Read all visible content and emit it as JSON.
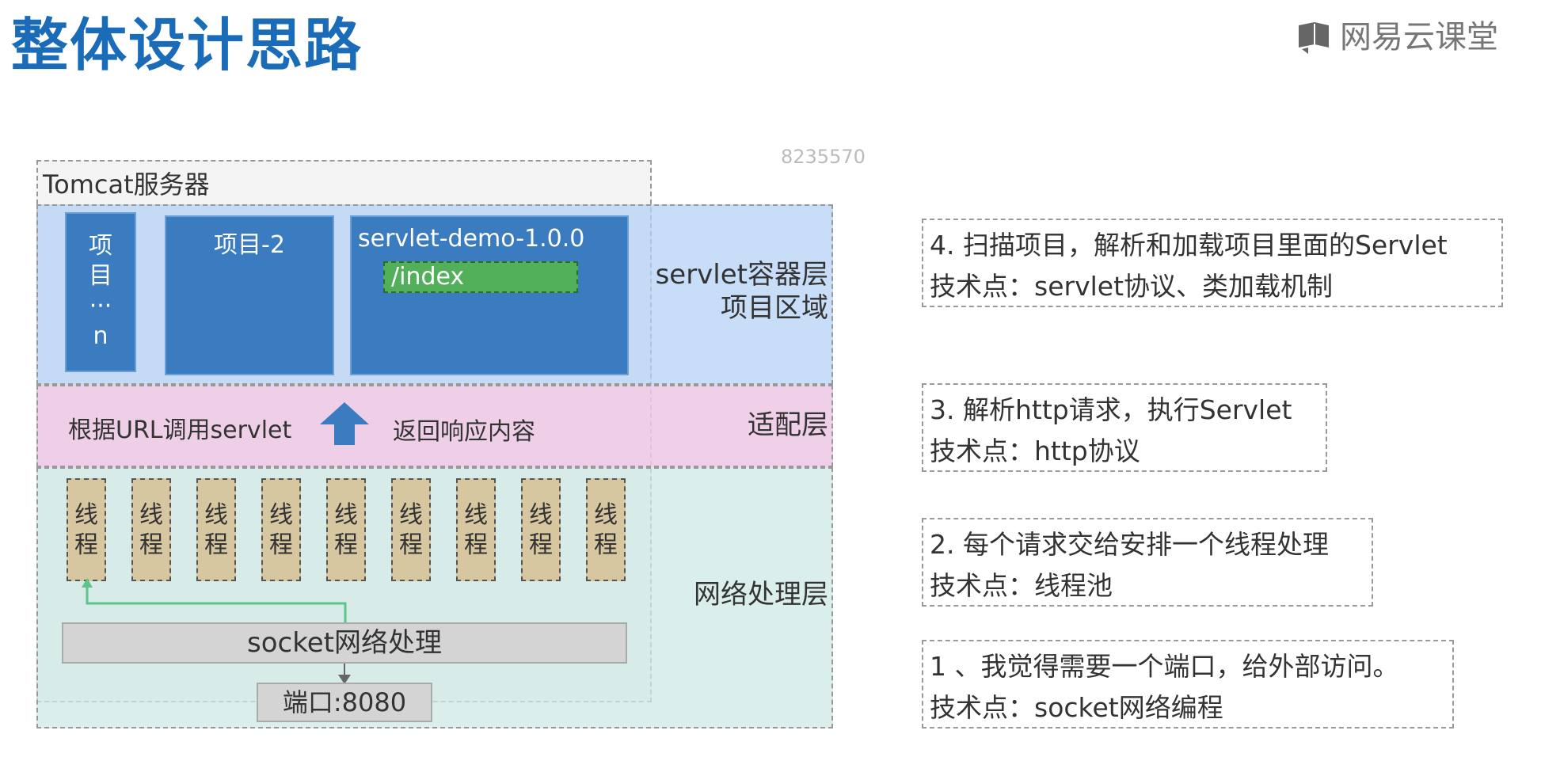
{
  "header": {
    "title": "整体设计思路",
    "logo_text": "网易云课堂"
  },
  "watermark": "8235570",
  "diagram": {
    "tomcat_label": "Tomcat服务器",
    "projects": {
      "n_label": "项\n目\n···\nn",
      "p2_label": "项目-2",
      "demo_label": "servlet-demo-1.0.0",
      "index_label": "/index"
    },
    "layers": {
      "servlet": "servlet容器层\n项目区域",
      "adapter": "适配层",
      "network": "网络处理层"
    },
    "adapter": {
      "left_text": "根据URL调用servlet",
      "right_text": "返回响应内容"
    },
    "threads": [
      "线\n程",
      "线\n程",
      "线\n程",
      "线\n程",
      "线\n程",
      "线\n程",
      "线\n程",
      "线\n程",
      "线\n程"
    ],
    "socket_label": "socket网络处理",
    "port_label": "端口:8080"
  },
  "steps": {
    "s4": {
      "line1": "4. 扫描项目，解析和加载项目里面的Servlet",
      "line2": "技术点：servlet协议、类加载机制"
    },
    "s3": {
      "line1": "3. 解析http请求，执行Servlet",
      "line2": "技术点：http协议"
    },
    "s2": {
      "line1": "2. 每个请求交给安排一个线程处理",
      "line2": "技术点：线程池"
    },
    "s1": {
      "line1": "1 、我觉得需要一个端口，给外部访问。",
      "line2": "技术点：socket网络编程"
    }
  },
  "colors": {
    "title": "#1a6bb8",
    "project": "#3b7cc1",
    "index": "#53b05a",
    "servlet_layer": "#b4d2f5",
    "adapter_layer": "#edc8e4",
    "network_layer": "#cde8e6",
    "thread": "#d6c7a0",
    "arrow": "#3b7cc1",
    "connector": "#5ec48a"
  }
}
